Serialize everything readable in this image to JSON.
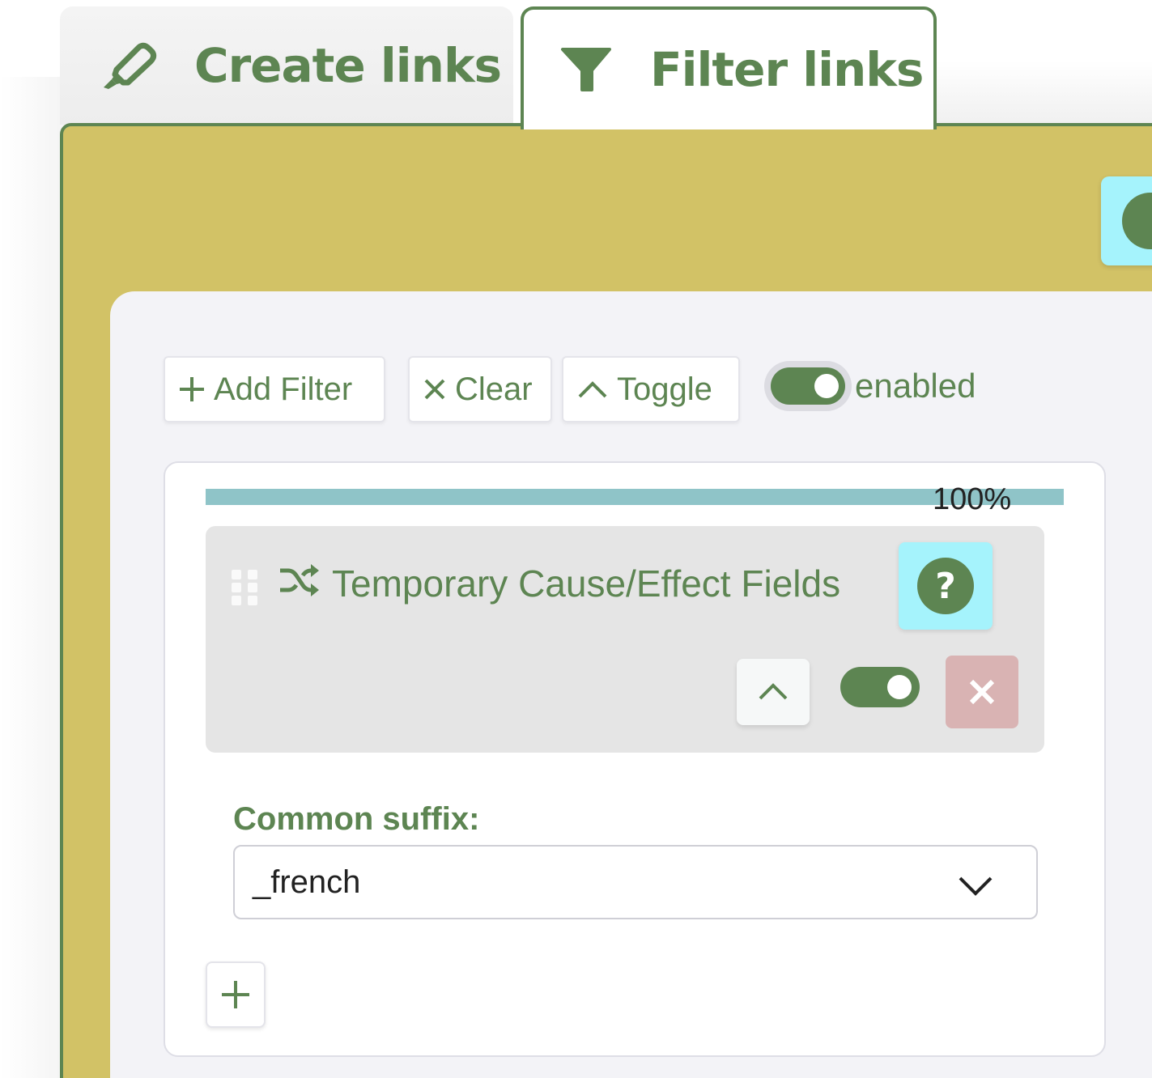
{
  "tabs": [
    {
      "label": "Create links",
      "icon": "highlighter-icon",
      "active": false
    },
    {
      "label": "Filter links",
      "icon": "filter-icon",
      "active": true
    }
  ],
  "toolbar": {
    "add_filter_label": "Add Filter",
    "clear_label": "Clear",
    "toggle_label": "Toggle",
    "enabled_label": "enabled",
    "enabled": true
  },
  "filter": {
    "progress_label": "100%",
    "progress": 1.0,
    "title": "Temporary Cause/Effect Fields",
    "icon": "shuffle-icon",
    "help_symbol": "?",
    "enabled": true
  },
  "field": {
    "label": "Common suffix:",
    "selected": "_french"
  },
  "colors": {
    "accent": "#5d8552",
    "panel": "#d2c266",
    "help_bg": "#a5f3fc",
    "remove_bg": "#d9b3b3",
    "progress": "#8fc4c8"
  }
}
